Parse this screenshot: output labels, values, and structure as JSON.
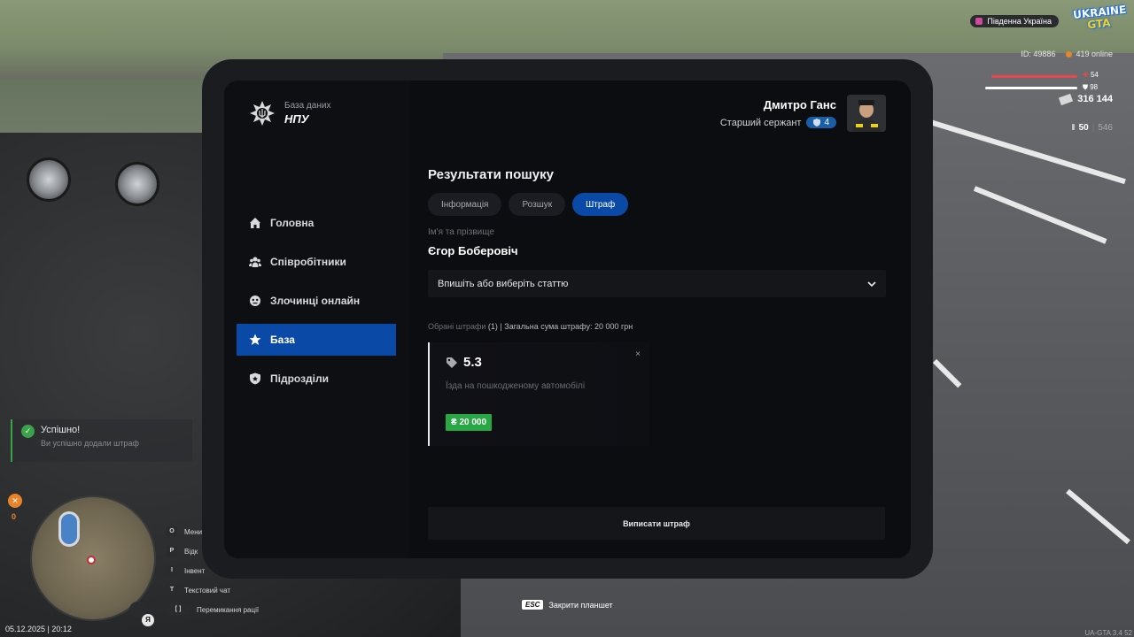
{
  "tablet": {
    "brand": {
      "subtitle": "База даних",
      "title": "НПУ"
    },
    "user": {
      "name": "Дмитро Ганс",
      "rank": "Старший сержант",
      "rank_level": "4"
    },
    "nav": [
      {
        "label": "Головна",
        "icon": "home-icon",
        "active": false
      },
      {
        "label": "Співробітники",
        "icon": "people-icon",
        "active": false
      },
      {
        "label": "Злочинці онлайн",
        "icon": "criminal-icon",
        "active": false
      },
      {
        "label": "База",
        "icon": "star-icon",
        "active": true
      },
      {
        "label": "Підрозділи",
        "icon": "shield-icon",
        "active": false
      }
    ],
    "main": {
      "title": "Результати пошуку",
      "tabs": [
        {
          "label": "Інформація",
          "active": false
        },
        {
          "label": "Розшук",
          "active": false
        },
        {
          "label": "Штраф",
          "active": true
        }
      ],
      "name_label": "Ім'я та прізвище",
      "person_name": "Єгор Боберовіч",
      "article_select_placeholder": "Впишіть або виберіть статтю",
      "summary_prefix": "Обрані штрафи",
      "summary_rest": " (1) | Загальна сума штрафу: 20 000 грн",
      "fine": {
        "code": "5.3",
        "description": "Їзда на пошкодженому автомобілі",
        "amount": "₴ 20 000",
        "close": "×"
      },
      "submit_label": "Виписати штраф"
    }
  },
  "hud": {
    "server": "Південна Україна",
    "logo_top": "UKRAINE",
    "logo_bottom": "GTA",
    "player_id": "ID: 49886",
    "online": "419 online",
    "health": "54",
    "armor": "98",
    "health_fraction": 0.54,
    "armor_fraction": 0.98,
    "money": "316 144",
    "ammo_clip": "50",
    "ammo_total": "546",
    "hunger_value": "0",
    "notification_title": "Успішно!",
    "notification_text": "Ви успішно додали штраф",
    "keybinds": [
      {
        "key": "O",
        "label": "Мени"
      },
      {
        "key": "P",
        "label": "Відк"
      },
      {
        "key": "I",
        "label": "Інвент"
      },
      {
        "key": "T",
        "label": "Текстовий чат"
      },
      {
        "key": "[ ]",
        "label": "Перемикання рації"
      }
    ],
    "lang": "Я",
    "datetime": "05.12.2025 | 20:12",
    "esc_key": "ESC",
    "esc_label": "Закрити планшет",
    "version": "UA-GTA 3.4 52"
  },
  "colors": {
    "accent": "#0a4aa6",
    "fine_green": "#28a745",
    "health": "#e8474f",
    "armor": "#ffffff"
  }
}
